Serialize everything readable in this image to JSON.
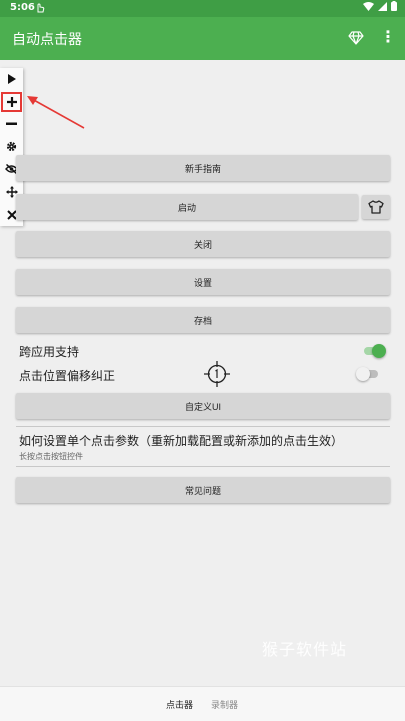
{
  "status_bar": {
    "time": "5:06"
  },
  "app_bar": {
    "title": "自动点击器"
  },
  "toolbar": {
    "items": [
      "play-icon",
      "plus-icon",
      "minus-icon",
      "gear-icon",
      "eye-off-icon",
      "move-icon",
      "close-icon"
    ],
    "highlighted": "plus-icon",
    "accent": "#e53935"
  },
  "buttons": {
    "guide": "新手指南",
    "start": "启动",
    "close": "关闭",
    "settings": "设置",
    "save": "存档",
    "custom_ui": "自定义UI",
    "faq": "常见问题"
  },
  "options": {
    "cross_app": {
      "label": "跨应用支持",
      "enabled": true
    },
    "offset_fix": {
      "label": "点击位置偏移纠正",
      "enabled": false
    }
  },
  "help": {
    "title": "如何设置单个点击参数（重新加载配置或新添加的点击生效）",
    "subtitle": "长按点击按钮控件"
  },
  "watermark": "猴子软件站",
  "bottom_nav": {
    "tabs": [
      "点击器",
      "录制器"
    ],
    "active": 0
  },
  "colors": {
    "primary": "#4caf50",
    "status": "#3f9e45",
    "toggle_on": "#4caf50"
  }
}
